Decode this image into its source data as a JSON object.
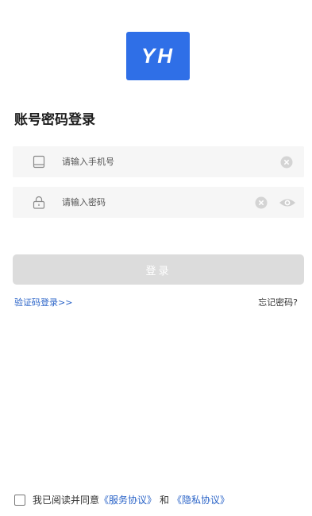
{
  "colors": {
    "logo_bg": "#2f6fe7",
    "link": "#2b64c8",
    "button_disabled_bg": "#dcdcdc",
    "field_bg": "#f6f6f6"
  },
  "logo": {
    "text": "YH"
  },
  "heading": "账号密码登录",
  "phone_field": {
    "placeholder": "请输入手机号",
    "value": "",
    "lead_icon": "phone-icon",
    "clear_icon": "clear-icon"
  },
  "password_field": {
    "placeholder": "请输入密码",
    "value": "",
    "lead_icon": "lock-icon",
    "clear_icon": "clear-icon",
    "toggle_icon": "eye-icon"
  },
  "login_button": {
    "label": "登录",
    "enabled": false
  },
  "sms_login_link": "验证码登录>>",
  "forgot_password_link": "忘记密码?",
  "agreement": {
    "checked": false,
    "prefix": "我已阅读并同意",
    "service_link": "《服务协议》",
    "connector": "和",
    "privacy_link": "《隐私协议》"
  }
}
